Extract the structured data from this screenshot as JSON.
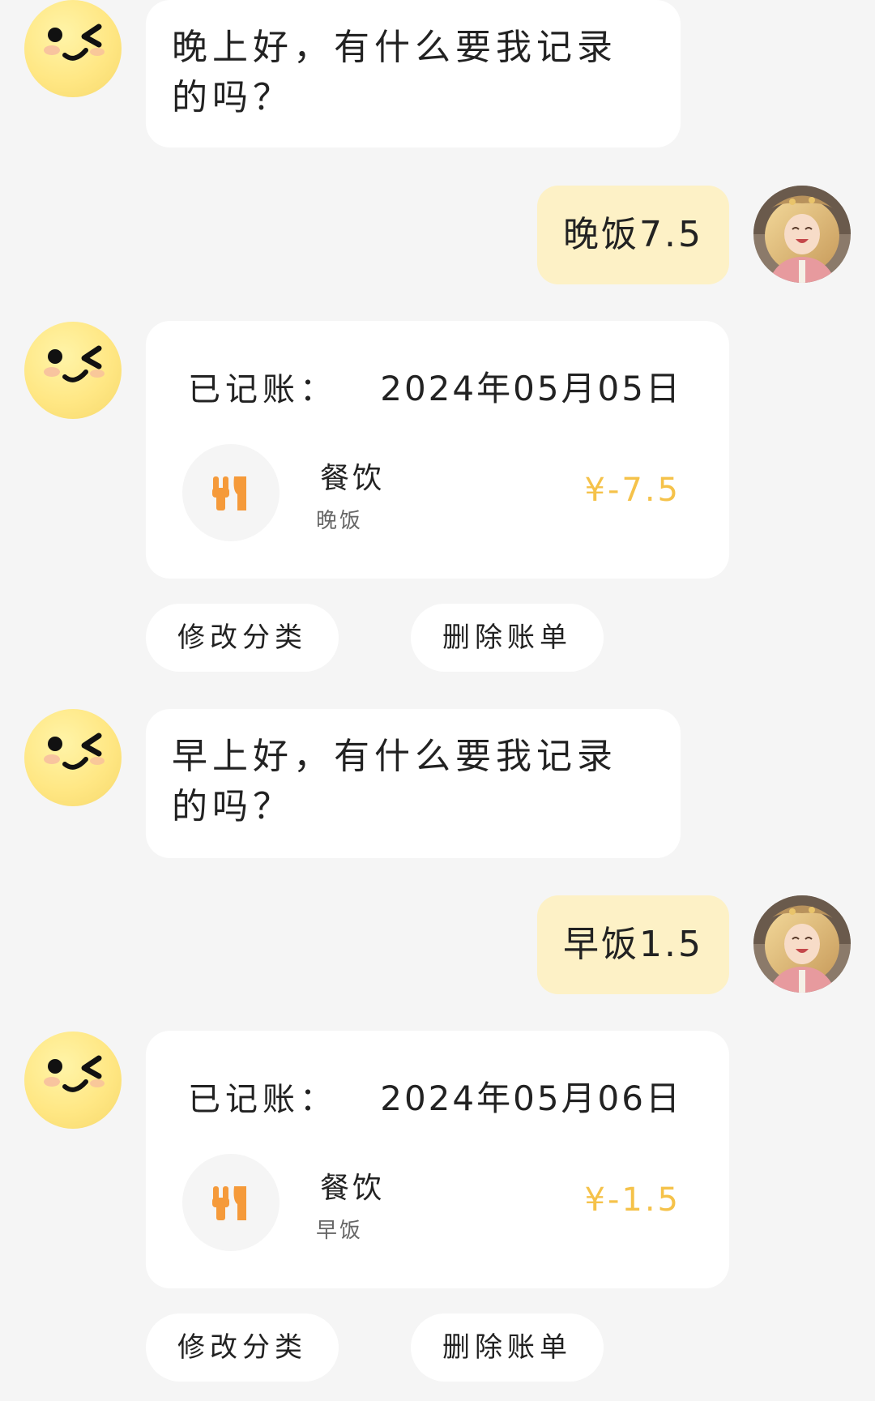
{
  "colors": {
    "background": "#f5f5f5",
    "user_bubble": "#fdf1c6",
    "amount": "#f5c24a",
    "icon_orange": "#f59a3a",
    "avatar_yellow": "#ffe784"
  },
  "messages": [
    {
      "type": "bot_text",
      "avatar_icon": "wink-face-icon",
      "text": "晚上好，有什么要我记录的吗？"
    },
    {
      "type": "user_text",
      "avatar_icon": "user-avatar",
      "text": "晚饭7.5"
    },
    {
      "type": "bot_record",
      "avatar_icon": "wink-face-icon",
      "label": "已记账：",
      "date": "2024年05月05日",
      "category_icon": "utensils-icon",
      "category": "餐饮",
      "note": "晚饭",
      "amount": "¥-7.5",
      "actions": {
        "edit_label": "修改分类",
        "delete_label": "删除账单"
      }
    },
    {
      "type": "bot_text",
      "avatar_icon": "wink-face-icon",
      "text": "早上好，有什么要我记录的吗？"
    },
    {
      "type": "user_text",
      "avatar_icon": "user-avatar",
      "text": "早饭1.5"
    },
    {
      "type": "bot_record",
      "avatar_icon": "wink-face-icon",
      "label": "已记账：",
      "date": "2024年05月06日",
      "category_icon": "utensils-icon",
      "category": "餐饮",
      "note": "早饭",
      "amount": "¥-1.5",
      "actions": {
        "edit_label": "修改分类",
        "delete_label": "删除账单"
      }
    }
  ]
}
